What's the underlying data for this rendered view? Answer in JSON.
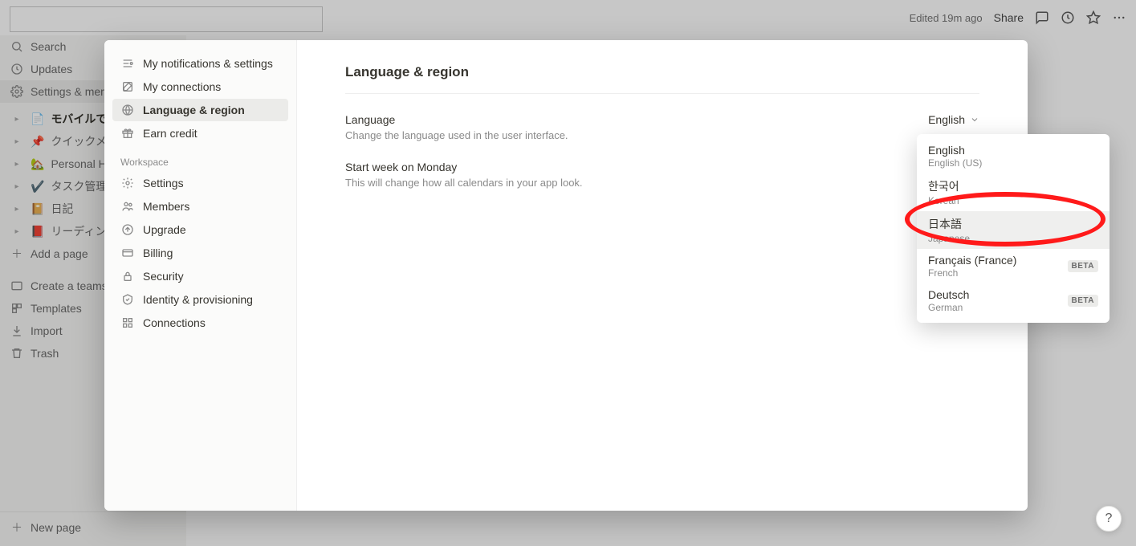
{
  "topbar": {
    "edited": "Edited 19m ago",
    "share": "Share"
  },
  "sidebar": {
    "search": "Search",
    "updates": "Updates",
    "settings": "Settings & members",
    "pages": [
      {
        "emoji": "📄",
        "label": "モバイルで使う",
        "bold": true
      },
      {
        "emoji": "📌",
        "label": "クイックメモ"
      },
      {
        "emoji": "🏡",
        "label": "Personal Home"
      },
      {
        "emoji": "✔️",
        "label": "タスク管理"
      },
      {
        "emoji": "📔",
        "label": "日記"
      },
      {
        "emoji": "📕",
        "label": "リーディングリスト"
      }
    ],
    "add_page": "Add a page",
    "teamspace": "Create a teamspace",
    "templates": "Templates",
    "import": "Import",
    "trash": "Trash",
    "new_page": "New page"
  },
  "modal": {
    "sidebar": {
      "account_items": [
        {
          "icon": "notif",
          "label": "My notifications & settings"
        },
        {
          "icon": "conn",
          "label": "My connections"
        },
        {
          "icon": "globe",
          "label": "Language & region",
          "active": true
        },
        {
          "icon": "gift",
          "label": "Earn credit"
        }
      ],
      "workspace_label": "Workspace",
      "workspace_items": [
        {
          "icon": "gear",
          "label": "Settings"
        },
        {
          "icon": "members",
          "label": "Members"
        },
        {
          "icon": "upgrade",
          "label": "Upgrade"
        },
        {
          "icon": "billing",
          "label": "Billing"
        },
        {
          "icon": "security",
          "label": "Security"
        },
        {
          "icon": "identity",
          "label": "Identity & provisioning"
        },
        {
          "icon": "apps",
          "label": "Connections"
        }
      ]
    },
    "main": {
      "title": "Language & region",
      "rows": [
        {
          "label": "Language",
          "desc": "Change the language used in the user interface.",
          "value": "English"
        },
        {
          "label": "Start week on Monday",
          "desc": "This will change how all calendars in your app look."
        }
      ]
    }
  },
  "popover": {
    "items": [
      {
        "primary": "English",
        "secondary": "English (US)"
      },
      {
        "primary": "한국어",
        "secondary": "Korean"
      },
      {
        "primary": "日本語",
        "secondary": "Japanese",
        "highlight": true
      },
      {
        "primary": "Français (France)",
        "secondary": "French",
        "beta": "BETA"
      },
      {
        "primary": "Deutsch",
        "secondary": "German",
        "beta": "BETA"
      }
    ]
  },
  "help": "?"
}
